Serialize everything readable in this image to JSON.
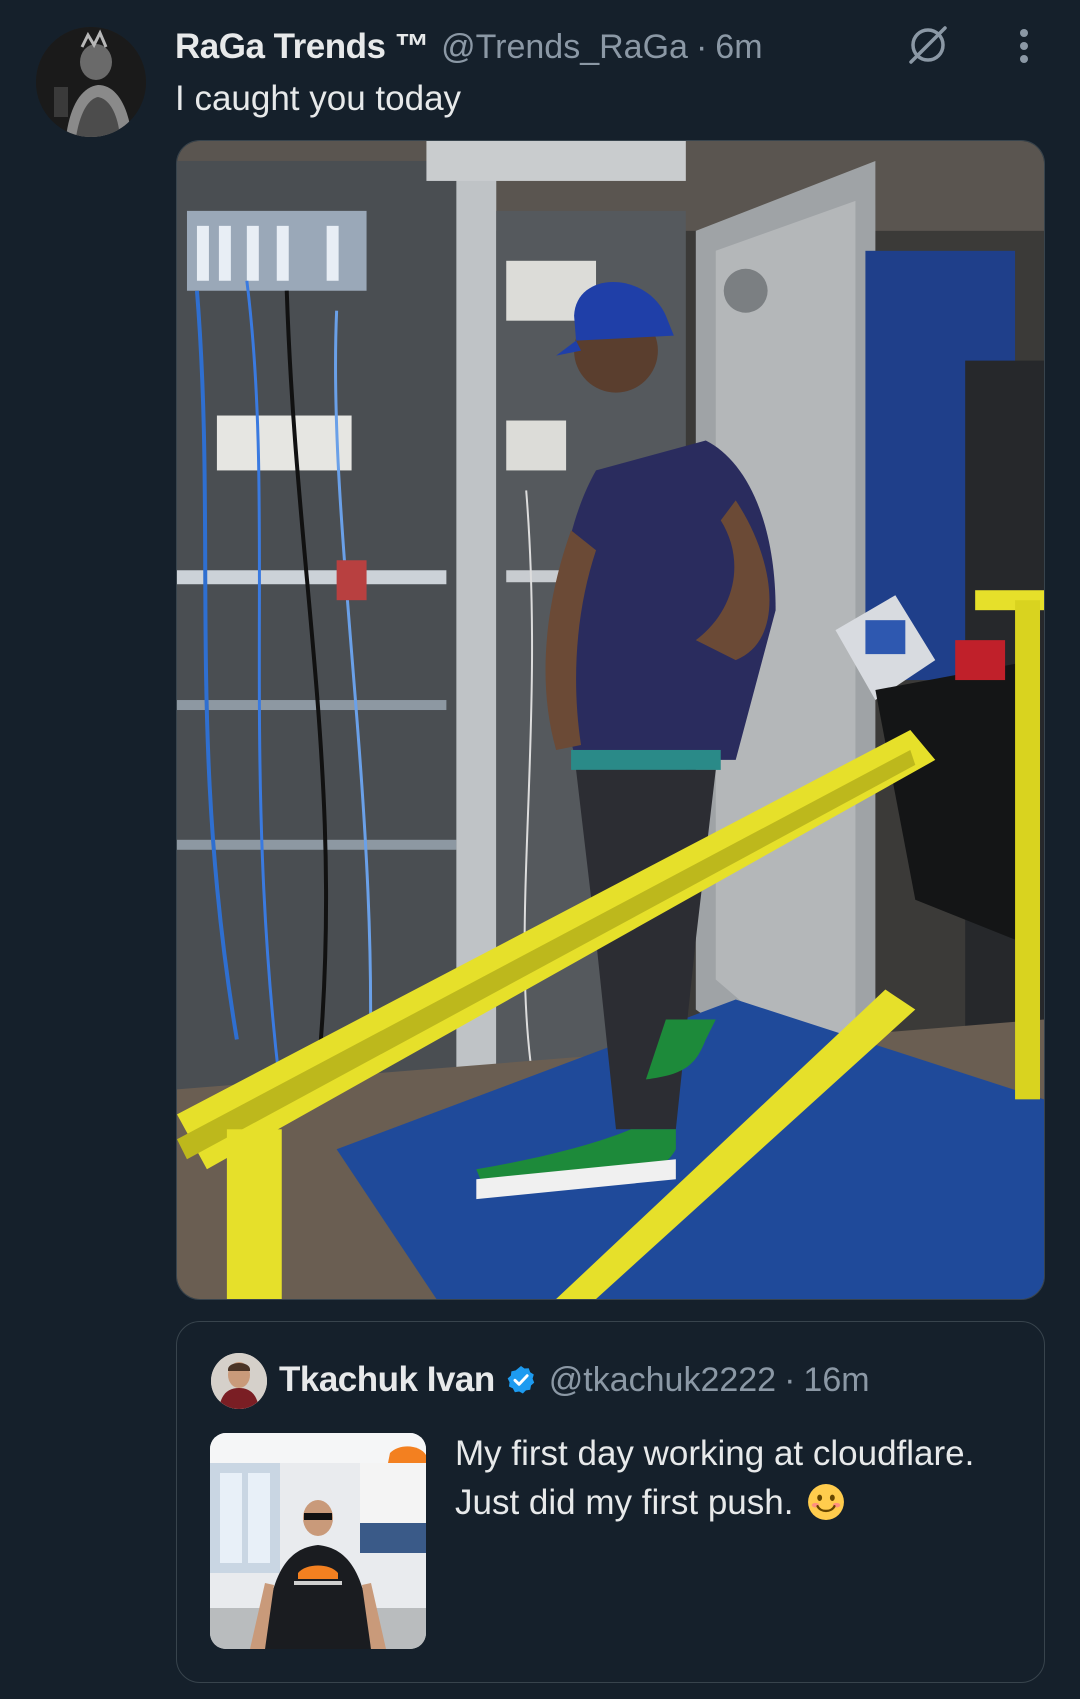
{
  "tweet": {
    "author": {
      "display_name": "RaGa Trends ™",
      "handle": "@Trends_RaGa",
      "separator": "·",
      "time": "6m"
    },
    "text": "I caught you today",
    "icons": {
      "grok": "grok-icon",
      "more": "more-vertical-icon"
    }
  },
  "quote": {
    "author": {
      "display_name": "Tkachuk Ivan",
      "verified": true,
      "handle": "@tkachuk2222",
      "separator": "·",
      "time": "16m"
    },
    "text": "My first day working at cloudflare. Just did my first push.",
    "emoji": "smiling-face-emoji"
  },
  "colors": {
    "background": "#15202b",
    "primary_text": "#e7e9ea",
    "secondary_text": "#8b98a5",
    "border": "#38444d",
    "verified": "#1d9bf0"
  }
}
